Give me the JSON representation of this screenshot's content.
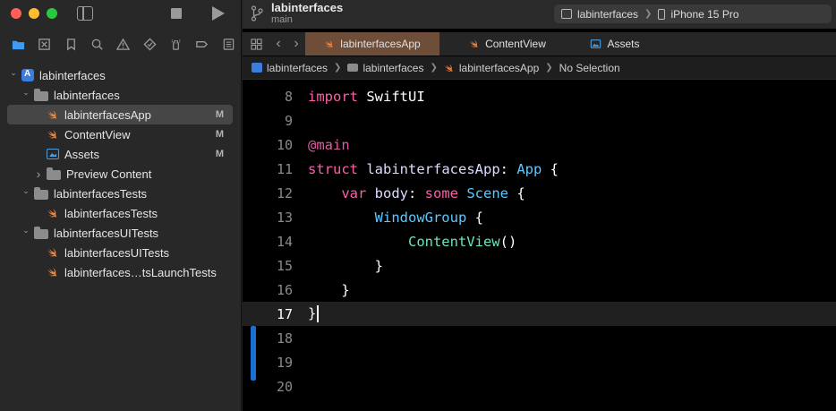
{
  "window": {
    "project_title": "labinterfaces",
    "branch": "main",
    "scheme": "labinterfaces",
    "device": "iPhone 15 Pro"
  },
  "navigator_tabs": [
    "folder-icon",
    "xmark-square-icon",
    "bookmark-icon",
    "magnifier-icon",
    "warning-icon",
    "test-diamond-icon",
    "debug-spray-icon",
    "breakpoint-icon",
    "report-icon"
  ],
  "tree": [
    {
      "label": "labinterfaces",
      "level": 0,
      "icon": "project-icon",
      "expanded": true,
      "badge": ""
    },
    {
      "label": "labinterfaces",
      "level": 1,
      "icon": "folder-icon",
      "expanded": true,
      "badge": ""
    },
    {
      "label": "labinterfacesApp",
      "level": 2,
      "icon": "swift-file-icon",
      "badge": "M",
      "selected": true
    },
    {
      "label": "ContentView",
      "level": 2,
      "icon": "swift-file-icon",
      "badge": "M"
    },
    {
      "label": "Assets",
      "level": 2,
      "icon": "asset-catalog-icon",
      "badge": "M"
    },
    {
      "label": "Preview Content",
      "level": 2,
      "icon": "folder-icon",
      "expanded": false,
      "badge": ""
    },
    {
      "label": "labinterfacesTests",
      "level": 1,
      "icon": "folder-icon",
      "expanded": true,
      "badge": ""
    },
    {
      "label": "labinterfacesTests",
      "level": 2,
      "icon": "swift-file-icon",
      "badge": ""
    },
    {
      "label": "labinterfacesUITests",
      "level": 1,
      "icon": "folder-icon",
      "expanded": true,
      "badge": ""
    },
    {
      "label": "labinterfacesUITests",
      "level": 2,
      "icon": "swift-file-icon",
      "badge": ""
    },
    {
      "label": "labinterfaces…tsLaunchTests",
      "level": 2,
      "icon": "swift-file-icon",
      "badge": ""
    }
  ],
  "tabs": [
    {
      "label": "labinterfacesApp",
      "active": true
    },
    {
      "label": "ContentView",
      "active": false
    },
    {
      "label": "Assets",
      "active": false
    }
  ],
  "breadcrumb": [
    "labinterfaces",
    "labinterfaces",
    "labinterfacesApp",
    "No Selection"
  ],
  "code": {
    "current_line": 17,
    "lines": [
      {
        "n": "8",
        "text": "import SwiftUI"
      },
      {
        "n": "9",
        "text": ""
      },
      {
        "n": "10",
        "text": "@main"
      },
      {
        "n": "11",
        "text": "struct labinterfacesApp: App {"
      },
      {
        "n": "12",
        "text": "    var body: some Scene {"
      },
      {
        "n": "13",
        "text": "        WindowGroup {"
      },
      {
        "n": "14",
        "text": "            ContentView()"
      },
      {
        "n": "15",
        "text": "        }"
      },
      {
        "n": "16",
        "text": "    }"
      },
      {
        "n": "17",
        "text": "}"
      },
      {
        "n": "18",
        "text": ""
      },
      {
        "n": "19",
        "text": ""
      },
      {
        "n": "20",
        "text": ""
      }
    ]
  },
  "colors": {
    "keyword": "#ff5fa8",
    "type": "#5ec8ff",
    "function": "#67e8b6",
    "active_tab": "#6e4e38"
  }
}
